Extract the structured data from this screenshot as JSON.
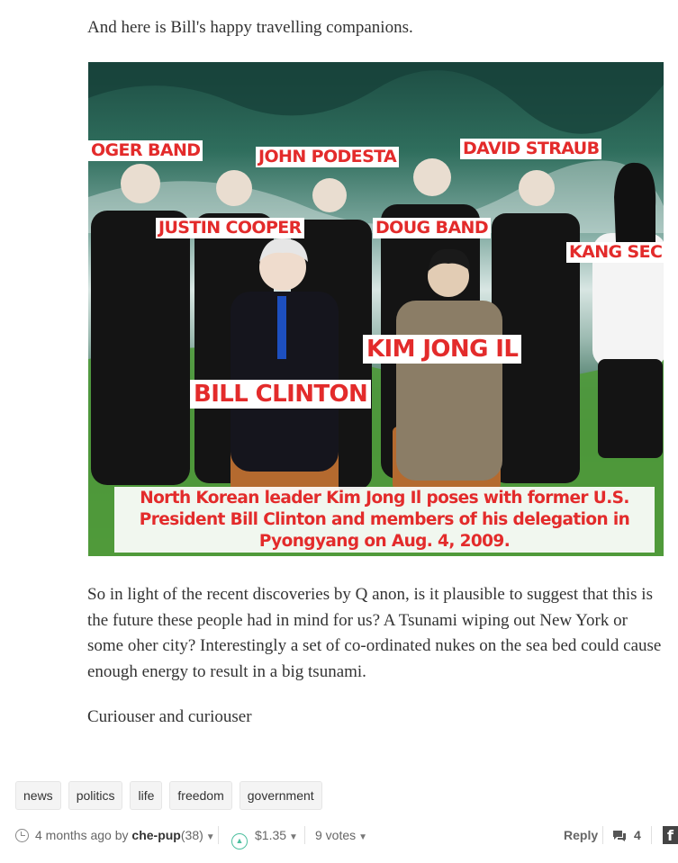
{
  "post": {
    "intro": "And here is Bill's happy travelling companions.",
    "paragraph2": "So in light of the recent discoveries by Q anon, is it plausible to suggest that this is the future these people had in mind for us? A Tsunami wiping out New York or some oher city? Interestingly a set of co-ordinated nukes on the sea bed could cause enough energy to result in a big tsunami.",
    "paragraph3": "Curiouser and curiouser"
  },
  "photo": {
    "labels": {
      "roger_band": "OGER BAND",
      "john_podesta": "JOHN PODESTA",
      "david_straub": "DAVID STRAUB",
      "justin_cooper": "JUSTIN COOPER",
      "doug_band": "DOUG BAND",
      "kang": "KANG SEC",
      "kim_jong_il": "KIM JONG IL",
      "bill_clinton": "BILL CLINTON"
    },
    "caption_lines": [
      "North Korean leader Kim Jong Il poses with former U.S.",
      "President Bill Clinton and members of his delegation in",
      "Pyongyang on Aug. 4, 2009."
    ]
  },
  "tags": [
    "news",
    "politics",
    "life",
    "freedom",
    "government"
  ],
  "footer": {
    "time": "4 months ago",
    "by": "by",
    "author": "che-pup",
    "reputation": "(38)",
    "payout": "$1.35",
    "votes": "9 votes",
    "reply": "Reply",
    "comments": "4",
    "share": "f"
  },
  "colors": {
    "label_red": "#e32b2b",
    "upvote": "#4dbf9f"
  },
  "icons": [
    "clock-icon",
    "upvote-icon",
    "comment-icon",
    "facebook-icon",
    "chevron-down-icon"
  ]
}
